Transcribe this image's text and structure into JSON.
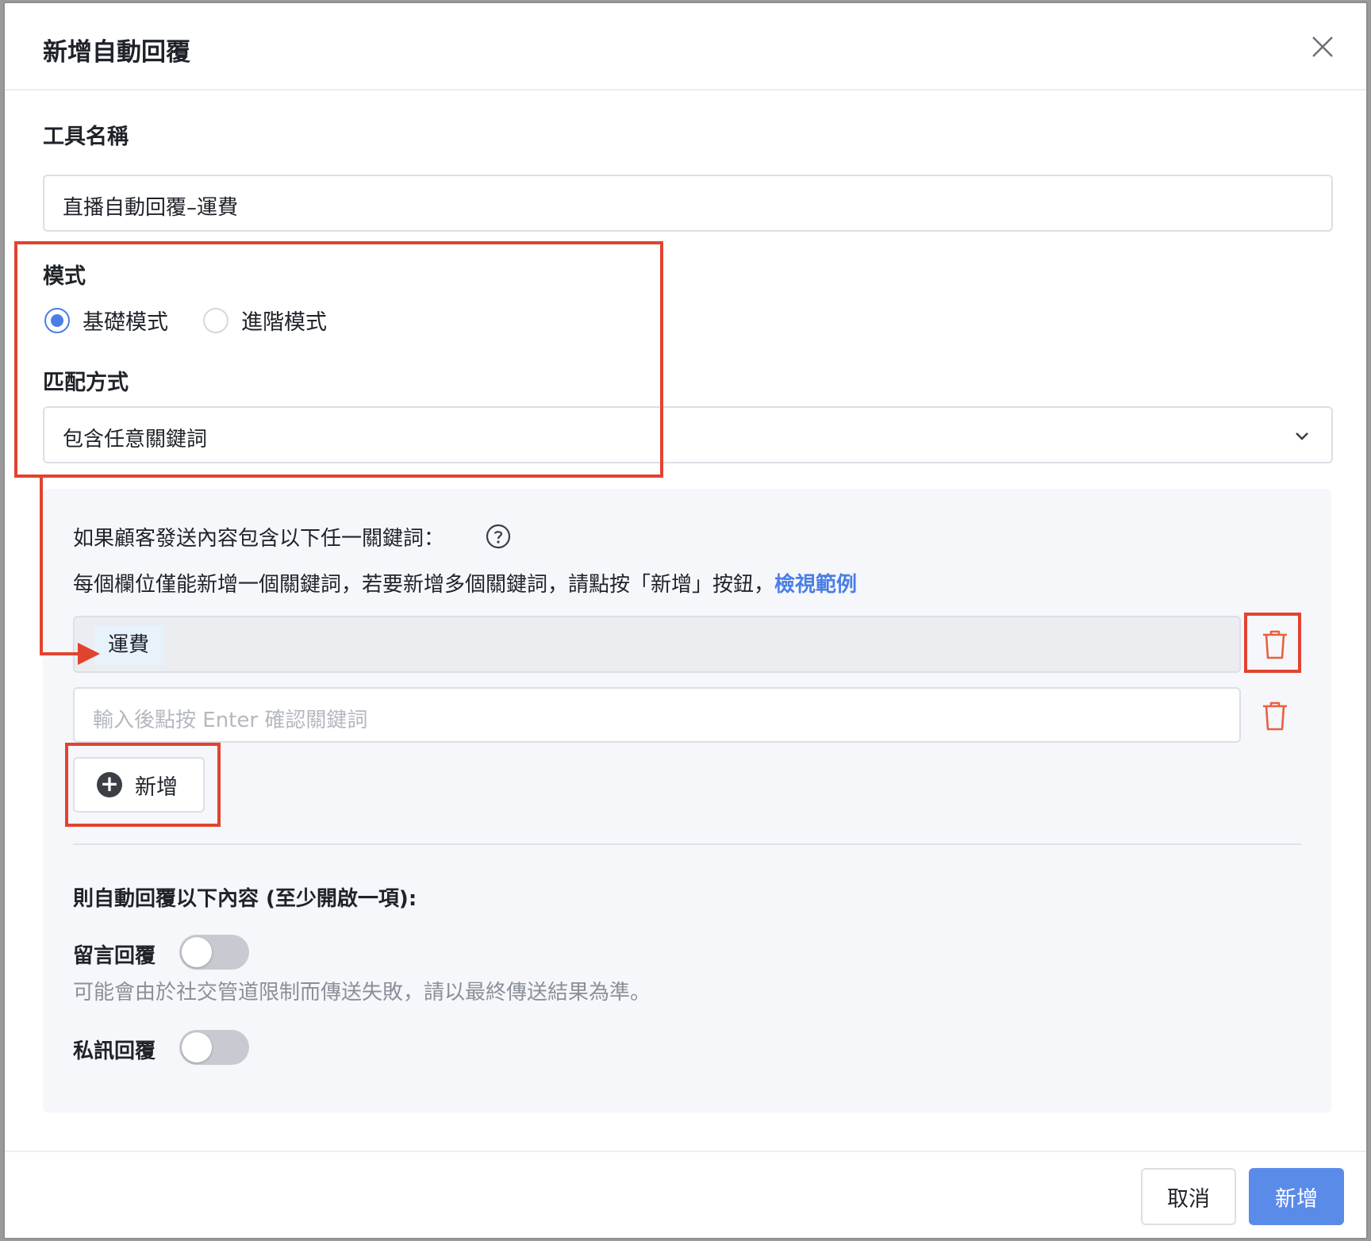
{
  "dialog": {
    "title": "新增自動回覆"
  },
  "tool_name": {
    "label": "工具名稱",
    "value": "直播自動回覆–運費"
  },
  "mode": {
    "label": "模式",
    "options": [
      {
        "label": "基礎模式",
        "selected": true
      },
      {
        "label": "進階模式",
        "selected": false
      }
    ]
  },
  "match": {
    "label": "匹配方式",
    "value": "包含任意關鍵詞"
  },
  "keywords": {
    "prompt": "如果顧客發送內容包含以下任一關鍵詞：",
    "instruction": "每個欄位僅能新增一個關鍵詞，若要新增多個關鍵詞，請點按「新增」按鈕，",
    "example_link": "檢視範例",
    "tags": [
      "運費"
    ],
    "input_placeholder": "輸入後點按 Enter 確認關鍵詞",
    "add_label": "新增"
  },
  "reply": {
    "heading": "則自動回覆以下內容 (至少開啟一項):",
    "comment_label": "留言回覆",
    "comment_enabled": false,
    "comment_hint": "可能會由於社交管道限制而傳送失敗，請以最終傳送結果為準。",
    "dm_label": "私訊回覆",
    "dm_enabled": false
  },
  "footer": {
    "cancel_label": "取消",
    "submit_label": "新增"
  },
  "colors": {
    "accent": "#4a7ee6",
    "primary_button": "#5b8be8",
    "annotation": "#e2432f",
    "danger": "#e8613f"
  },
  "icons": [
    "close-icon",
    "chevron-down-icon",
    "help-circle-icon",
    "trash-icon",
    "plus-circle-icon"
  ]
}
